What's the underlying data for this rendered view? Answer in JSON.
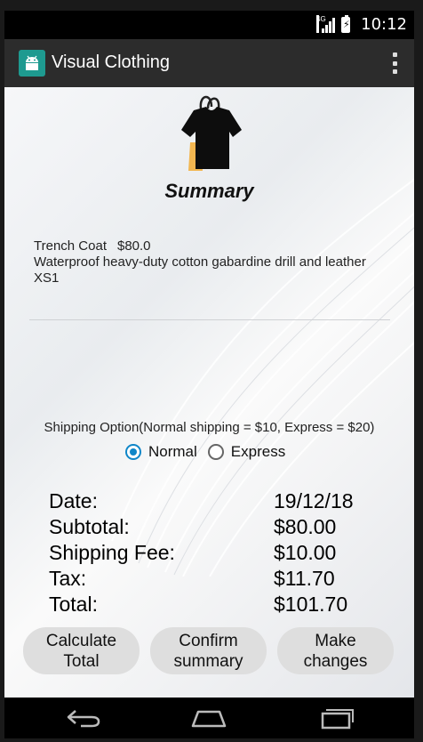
{
  "status_bar": {
    "time": "10:12",
    "network": "4G"
  },
  "app_bar": {
    "title": "Visual Clothing"
  },
  "summary": {
    "title": "Summary"
  },
  "item": {
    "name": "Trench Coat",
    "price": "$80.0",
    "description": "Waterproof heavy-duty cotton gabardine drill and leather",
    "size": "XS1"
  },
  "shipping": {
    "label": "Shipping Option(Normal shipping = $10, Express = $20)",
    "options": [
      "Normal",
      "Express"
    ],
    "selected": "Normal"
  },
  "totals": [
    {
      "label": "Date:",
      "value": "19/12/18"
    },
    {
      "label": "Subtotal:",
      "value": "$80.00"
    },
    {
      "label": "Shipping Fee:",
      "value": "$10.00"
    },
    {
      "label": "Tax:",
      "value": "$11.70"
    },
    {
      "label": "Total:",
      "value": "$101.70"
    }
  ],
  "buttons": {
    "calculate": [
      "Calculate",
      "Total"
    ],
    "confirm": [
      "Confirm",
      "summary"
    ],
    "make_changes": [
      "Make",
      "changes"
    ]
  },
  "colors": {
    "app_bar": "#2c2c2c",
    "app_icon": "#1e9a90",
    "radio_accent": "#0f86c8",
    "button_bg": "#dedede"
  },
  "icons": {
    "app": "android-icon",
    "bag": "shopping-bag-shirt-icon",
    "overflow": "more-vert-icon",
    "back": "back-icon",
    "home": "home-icon",
    "recents": "recents-icon"
  }
}
